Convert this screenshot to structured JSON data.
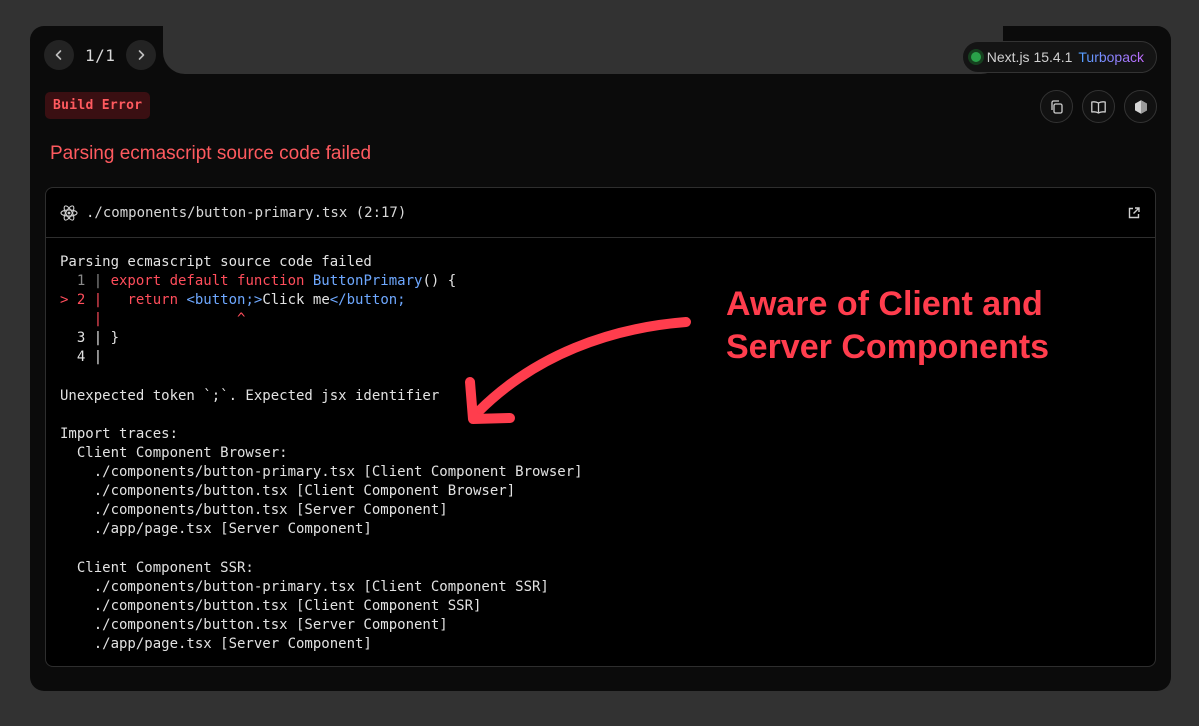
{
  "nav": {
    "counter": "1/1"
  },
  "version": {
    "label": "Next.js 15.4.1",
    "bundler": "Turbopack",
    "status_color": "#2aa24a"
  },
  "error": {
    "badge": "Build Error",
    "title": "Parsing ecmascript source code failed"
  },
  "file": {
    "path": "./components/button-primary.tsx (2:17)"
  },
  "code": {
    "heading": "Parsing ecmascript source code failed",
    "line1": {
      "gutter": "  1 | ",
      "kw": "export default function ",
      "fn": "ButtonPrimary",
      "rest": "() {"
    },
    "line2": {
      "marker": "> 2 | ",
      "pad": "  ",
      "kw": "return ",
      "tag_open": "<button;>",
      "text": "Click me",
      "tag_close": "</button;"
    },
    "caret": "    |                ^",
    "line3": "  3 | }",
    "line4": "  4 |",
    "message": "Unexpected token `;`. Expected jsx identifier",
    "traces_heading": "Import traces:",
    "browser_heading": "  Client Component Browser:",
    "browser": [
      "    ./components/button-primary.tsx [Client Component Browser]",
      "    ./components/button.tsx [Client Component Browser]",
      "    ./components/button.tsx [Server Component]",
      "    ./app/page.tsx [Server Component]"
    ],
    "ssr_heading": "  Client Component SSR:",
    "ssr": [
      "    ./components/button-primary.tsx [Client Component SSR]",
      "    ./components/button.tsx [Client Component SSR]",
      "    ./components/button.tsx [Server Component]",
      "    ./app/page.tsx [Server Component]"
    ]
  },
  "annotation": {
    "line1": "Aware of Client and",
    "line2": "Server Components",
    "color": "#ff3d4d"
  }
}
